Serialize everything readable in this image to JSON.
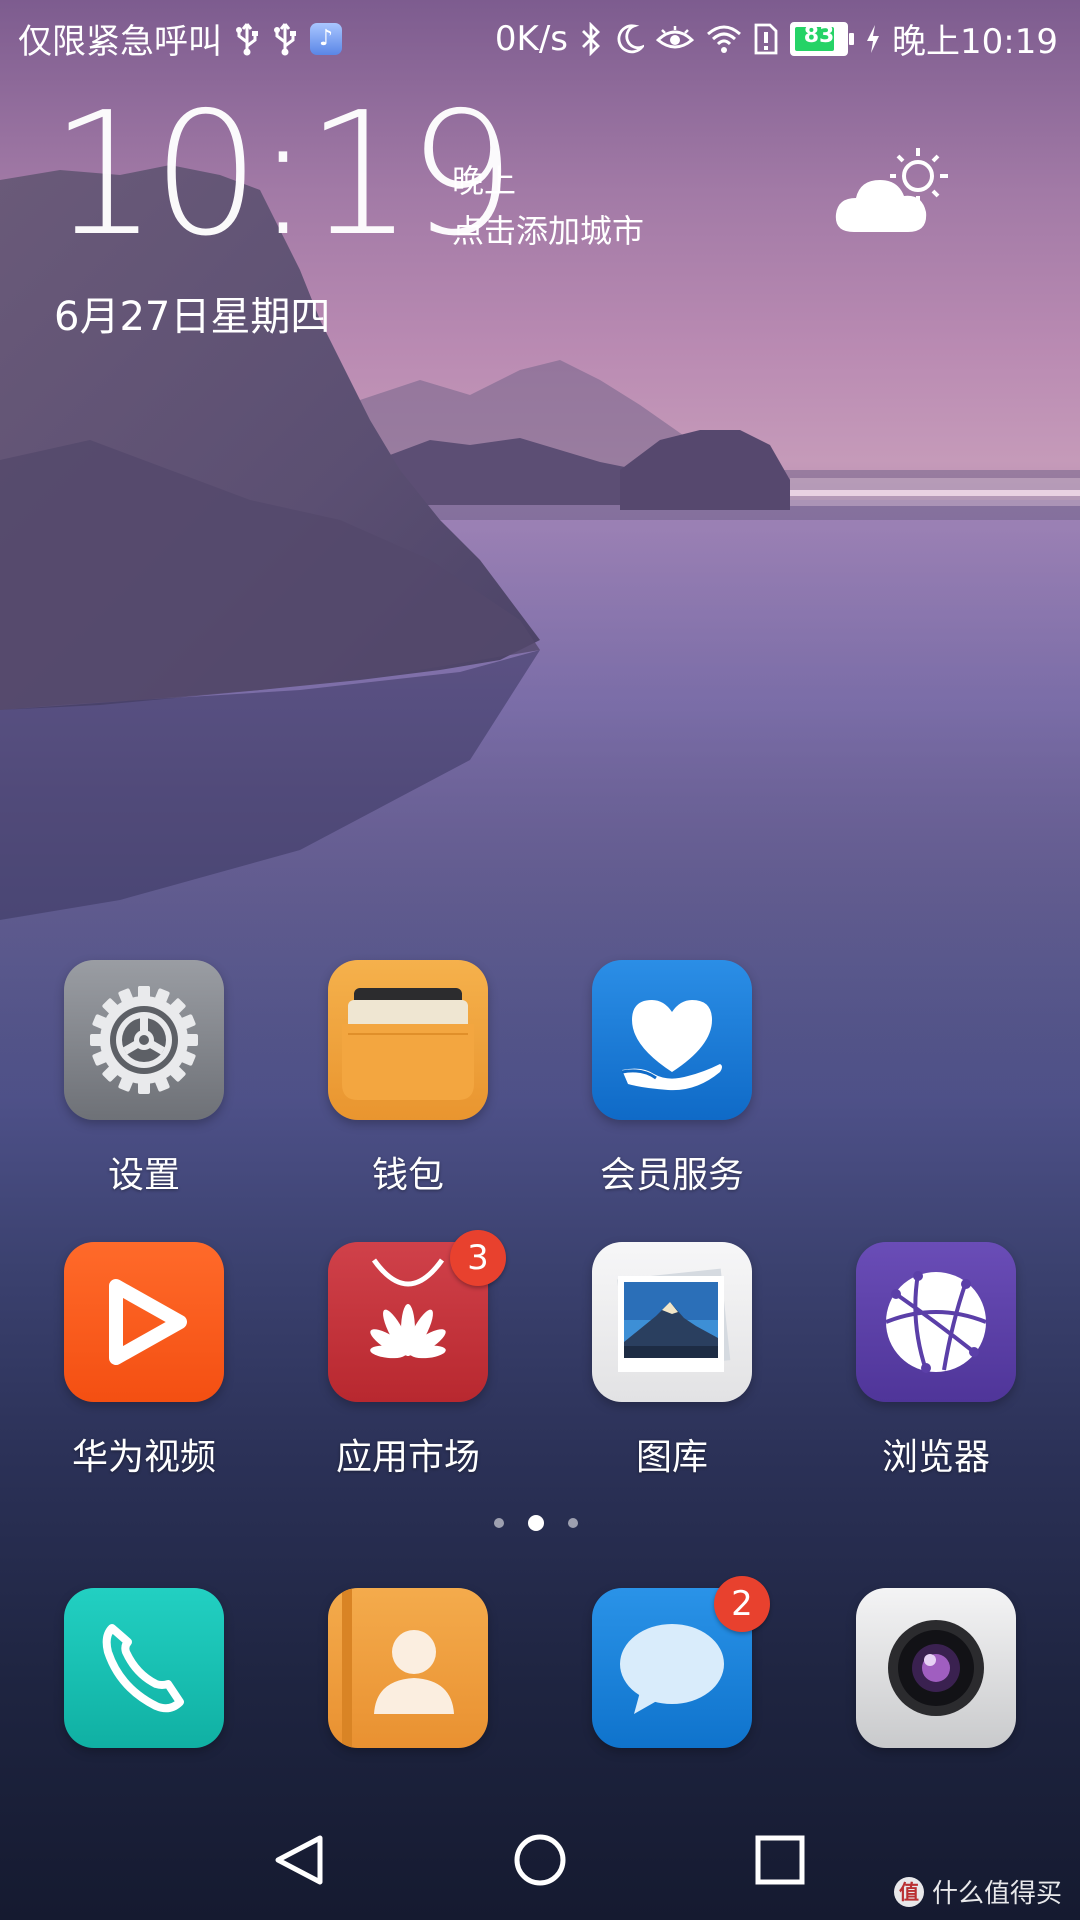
{
  "status_bar": {
    "carrier_text": "仅限紧急呼叫",
    "net_speed": "0K/s",
    "battery_level": "83",
    "battery_fraction": 0.83,
    "time": "晚上10:19",
    "left_icons": [
      "usb-icon",
      "usb-icon",
      "music-app-icon"
    ],
    "right_icons": [
      "bluetooth-icon",
      "do-not-disturb-moon-icon",
      "eye-comfort-icon",
      "wifi-icon",
      "sim-alert-icon",
      "battery-icon",
      "charging-icon"
    ]
  },
  "clock_widget": {
    "time": "10:19",
    "am_pm": "晚上",
    "city_prompt": "点击添加城市",
    "date": "6月27日星期四",
    "weather_icon": "partly-cloudy-icon"
  },
  "apps": [
    {
      "label": "设置",
      "icon": "settings-gear-icon",
      "badge": null
    },
    {
      "label": "钱包",
      "icon": "wallet-icon",
      "badge": null
    },
    {
      "label": "会员服务",
      "icon": "heart-hand-icon",
      "badge": null
    },
    {
      "label": "华为视频",
      "icon": "video-play-icon",
      "badge": null
    },
    {
      "label": "应用市场",
      "icon": "huawei-bag-icon",
      "badge": "3"
    },
    {
      "label": "图库",
      "icon": "gallery-photo-icon",
      "badge": null
    },
    {
      "label": "浏览器",
      "icon": "globe-icon",
      "badge": null
    }
  ],
  "dock": [
    {
      "icon": "phone-icon",
      "badge": null
    },
    {
      "icon": "contacts-icon",
      "badge": null
    },
    {
      "icon": "messages-icon",
      "badge": "2"
    },
    {
      "icon": "camera-icon",
      "badge": null
    }
  ],
  "page_indicator": {
    "pages": 3,
    "current": 2
  },
  "nav_bar": [
    "back-icon",
    "home-icon",
    "recents-icon"
  ],
  "watermark": {
    "text": "什么值得买",
    "logo_char": "值"
  },
  "colors": {
    "badge": "#e8412e",
    "settings": "#8a8d93",
    "wallet": "#f0a53f",
    "vip": "#1a7ad6",
    "video": "#ff5a1e",
    "market": "#c8323a",
    "browser": "#5b3fa8",
    "phone": "#18c3b3",
    "contacts": "#f1a040",
    "messages": "#1d86dd"
  }
}
